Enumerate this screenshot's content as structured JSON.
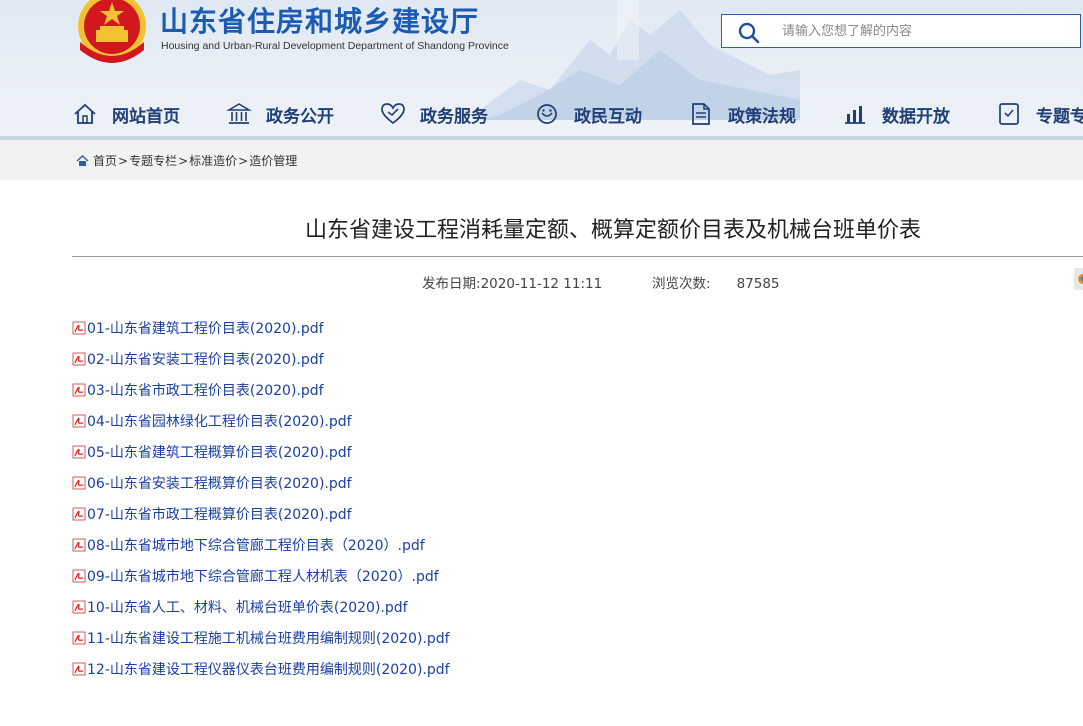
{
  "header": {
    "site_title": "山东省住房和城乡建设厅",
    "site_subtitle": "Housing and Urban-Rural Development Department of Shandong Province",
    "search_placeholder": "请输入您想了解的内容",
    "search_value": ""
  },
  "nav": {
    "items": [
      {
        "label": "网站首页",
        "icon": "home-icon"
      },
      {
        "label": "政务公开",
        "icon": "government-building-icon"
      },
      {
        "label": "政务服务",
        "icon": "service-heart-icon"
      },
      {
        "label": "政民互动",
        "icon": "interaction-icon"
      },
      {
        "label": "政策法规",
        "icon": "document-icon"
      },
      {
        "label": "数据开放",
        "icon": "bar-chart-icon"
      },
      {
        "label": "专题专",
        "icon": "topic-icon"
      }
    ]
  },
  "breadcrumb": {
    "items": [
      "首页",
      "专题专栏",
      "标准造价",
      "造价管理"
    ],
    "separator": ">"
  },
  "article": {
    "title": "山东省建设工程消耗量定额、概算定额价目表及机械台班单价表",
    "publish_label": "发布日期:",
    "publish_date": "2020-11-12 11:11",
    "views_label": "浏览次数:",
    "views_count": "87585",
    "files": [
      "01-山东省建筑工程价目表(2020).pdf",
      "02-山东省安装工程价目表(2020).pdf",
      "03-山东省市政工程价目表(2020).pdf",
      "04-山东省园林绿化工程价目表(2020).pdf",
      "05-山东省建筑工程概算价目表(2020).pdf",
      "06-山东省安装工程概算价目表(2020).pdf",
      "07-山东省市政工程概算价目表(2020).pdf",
      "08-山东省城市地下综合管廊工程价目表（2020）.pdf",
      "09-山东省城市地下综合管廊工程人材机表（2020）.pdf",
      "10-山东省人工、材料、机械台班单价表(2020).pdf",
      "11-山东省建设工程施工机械台班费用编制规则(2020).pdf",
      "12-山东省建设工程仪器仪表台班费用编制规则(2020).pdf"
    ]
  },
  "colors": {
    "brand_blue": "#1b5bb1",
    "nav_text": "#1f3f76",
    "link": "#1a3fa5",
    "emblem_red": "#d2181f",
    "emblem_gold": "#f2c230"
  }
}
